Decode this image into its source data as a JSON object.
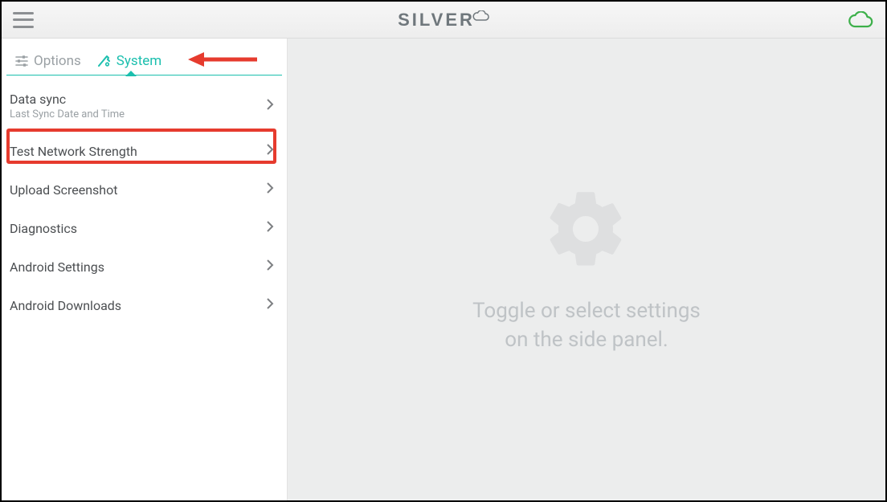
{
  "brand": "SILVER",
  "tabs": {
    "options": {
      "label": "Options"
    },
    "system": {
      "label": "System"
    }
  },
  "sidebar": {
    "items": [
      {
        "title": "Data sync",
        "subtitle": "Last Sync Date and Time"
      },
      {
        "title": "Test Network Strength"
      },
      {
        "title": "Upload Screenshot"
      },
      {
        "title": "Diagnostics"
      },
      {
        "title": "Android Settings"
      },
      {
        "title": "Android Downloads"
      }
    ],
    "highlighted_index": 1
  },
  "main": {
    "placeholder_line1": "Toggle or select settings",
    "placeholder_line2": "on the side panel."
  },
  "colors": {
    "accent": "#1bbfae",
    "highlight": "#e63b2e",
    "cloud": "#3db04a"
  }
}
